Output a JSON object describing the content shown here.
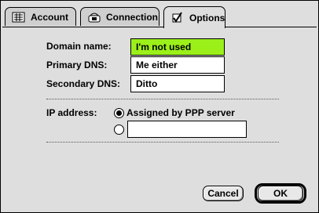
{
  "tabs": [
    {
      "label": "Account",
      "icon": "account-icon",
      "active": false
    },
    {
      "label": "Connection",
      "icon": "connection-icon",
      "active": false
    },
    {
      "label": "Options",
      "icon": "checkbox-icon",
      "active": true
    }
  ],
  "form": {
    "domain_label": "Domain name:",
    "domain_value": "I'm not used",
    "primary_dns_label": "Primary DNS:",
    "primary_dns_value": "Me either",
    "secondary_dns_label": "Secondary DNS:",
    "secondary_dns_value": "Ditto",
    "ip_label": "IP address:",
    "ip_option_ppp": "Assigned by PPP server",
    "ip_option_ppp_selected": true,
    "ip_manual_value": ""
  },
  "buttons": {
    "cancel": "Cancel",
    "ok": "OK"
  },
  "colors": {
    "highlight_field": "#9cf01a"
  }
}
